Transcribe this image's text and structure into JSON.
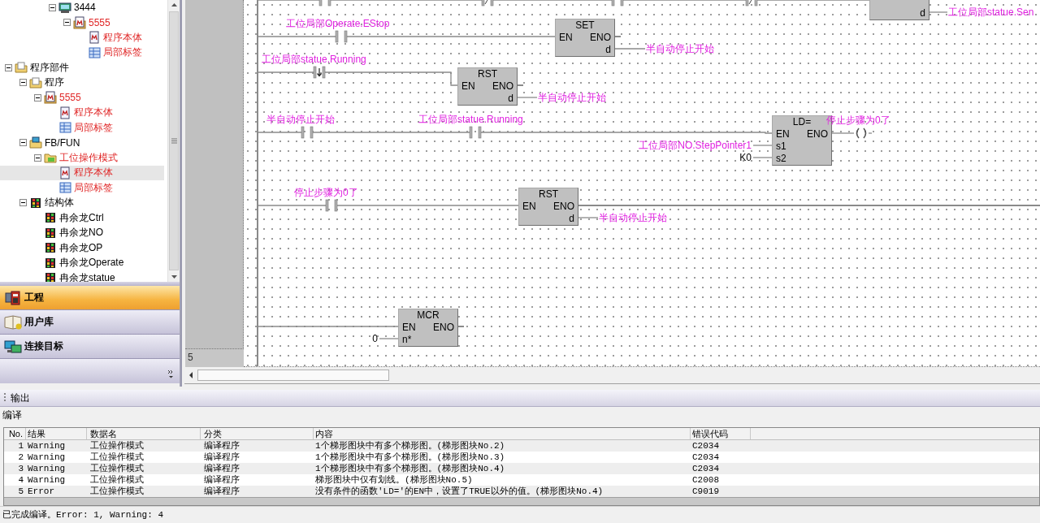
{
  "tree": {
    "scrolled_items": [
      {
        "label": "3444",
        "kind": "module",
        "error": false,
        "selected": false,
        "expanded": true,
        "children": [
          {
            "label": "5555",
            "kind": "pou",
            "error": true,
            "selected": false,
            "expanded": true,
            "children": [
              {
                "label": "程序本体",
                "kind": "body",
                "error": true,
                "selected": false
              },
              {
                "label": "局部标签",
                "kind": "label",
                "error": true,
                "selected": false
              }
            ]
          }
        ]
      }
    ],
    "items": [
      {
        "label": "程序部件",
        "kind": "folder",
        "error": false,
        "selected": false,
        "expanded": true,
        "children": [
          {
            "label": "程序",
            "kind": "folder",
            "error": false,
            "selected": false,
            "expanded": true,
            "children": [
              {
                "label": "5555",
                "kind": "pou",
                "error": true,
                "selected": false,
                "expanded": true,
                "children": [
                  {
                    "label": "程序本体",
                    "kind": "body",
                    "error": true,
                    "selected": false
                  },
                  {
                    "label": "局部标签",
                    "kind": "label",
                    "error": true,
                    "selected": false
                  }
                ]
              }
            ]
          },
          {
            "label": "FB/FUN",
            "kind": "fbfolder",
            "error": false,
            "selected": false,
            "expanded": true,
            "children": [
              {
                "label": "工位操作模式",
                "kind": "fb",
                "error": true,
                "selected": false,
                "expanded": true,
                "children": [
                  {
                    "label": "程序本体",
                    "kind": "body",
                    "error": true,
                    "selected": true
                  },
                  {
                    "label": "局部标签",
                    "kind": "label",
                    "error": true,
                    "selected": false
                  }
                ]
              }
            ]
          },
          {
            "label": "结构体",
            "kind": "struct",
            "error": false,
            "selected": false,
            "expanded": true,
            "children": [
              {
                "label": "冉余龙Ctrl",
                "kind": "struct",
                "error": false,
                "selected": false
              },
              {
                "label": "冉余龙NO",
                "kind": "struct",
                "error": false,
                "selected": false
              },
              {
                "label": "冉余龙OP",
                "kind": "struct",
                "error": false,
                "selected": false
              },
              {
                "label": "冉余龙Operate",
                "kind": "struct",
                "error": false,
                "selected": false
              },
              {
                "label": "冉余龙statue",
                "kind": "struct",
                "error": false,
                "selected": false
              }
            ]
          }
        ]
      }
    ]
  },
  "nav": [
    {
      "label": "工程",
      "kind": "project",
      "selected": true
    },
    {
      "label": "用户库",
      "kind": "library",
      "selected": false
    },
    {
      "label": "连接目标",
      "kind": "connection",
      "selected": false
    }
  ],
  "ladder": {
    "rungs": [
      {
        "contacts": [
          {
            "kind": "no"
          },
          {
            "kind": "nc"
          },
          {
            "kind": "no"
          },
          {
            "kind": "nc"
          }
        ],
        "block": {
          "outputs": [
            {
              "pin": "d",
              "target": "工位局部statue.Sen"
            }
          ]
        }
      },
      {
        "contacts": [
          {
            "label": "工位局部Operate.EStop",
            "kind": "no"
          }
        ],
        "block": {
          "name": "SET",
          "en": "EN",
          "eno": "ENO",
          "eno_continues": false,
          "outputs": [
            {
              "pin": "d",
              "target": "半自动停止开始"
            }
          ]
        }
      },
      {
        "contacts": [
          {
            "label": "工位局部statue.Running",
            "kind": "falling"
          }
        ],
        "block": {
          "name": "RST",
          "en": "EN",
          "eno": "ENO",
          "eno_continues": false,
          "outputs": [
            {
              "pin": "d",
              "target": "半自动停止开始"
            }
          ]
        }
      },
      {
        "contacts": [
          {
            "label": "半自动停止开始",
            "kind": "no"
          },
          {
            "label": "工位局部statue.Running",
            "kind": "no"
          }
        ],
        "block": {
          "name": "LD=",
          "en": "EN",
          "eno": "ENO",
          "inputs": [
            {
              "pin": "s1",
              "source": "工位局部NO.StepPointer1",
              "kind": "variable"
            },
            {
              "pin": "s2",
              "source": "K0",
              "kind": "constant"
            }
          ]
        },
        "coil": {
          "label": "停止步骤为0了"
        }
      },
      {
        "contacts": [
          {
            "label": "停止步骤为0了",
            "kind": "no"
          }
        ],
        "block": {
          "name": "RST",
          "en": "EN",
          "eno": "ENO",
          "eno_continues": true,
          "outputs": [
            {
              "pin": "d",
              "target": "半自动停止开始"
            }
          ]
        }
      },
      {
        "block": {
          "name": "MCR",
          "en": "EN",
          "eno": "ENO",
          "eno_continues": false,
          "inputs": [
            {
              "pin": "n*",
              "source": "0",
              "kind": "constant"
            }
          ]
        }
      }
    ],
    "row_number": "5"
  },
  "output": {
    "title": "输出",
    "section": "编译",
    "columns": [
      "No.",
      "结果",
      "数据名",
      "分类",
      "内容",
      "错误代码"
    ],
    "rows": [
      [
        "1",
        "Warning",
        "工位操作模式",
        "编译程序",
        "1个梯形图块中有多个梯形图。(梯形图块No.2)",
        "C2034"
      ],
      [
        "2",
        "Warning",
        "工位操作模式",
        "编译程序",
        "1个梯形图块中有多个梯形图。(梯形图块No.3)",
        "C2034"
      ],
      [
        "3",
        "Warning",
        "工位操作模式",
        "编译程序",
        "1个梯形图块中有多个梯形图。(梯形图块No.4)",
        "C2034"
      ],
      [
        "4",
        "Warning",
        "工位操作模式",
        "编译程序",
        "梯形图块中仅有划线。(梯形图块No.5)",
        "C2008"
      ],
      [
        "5",
        "Error",
        "工位操作模式",
        "编译程序",
        "没有条件的函数'LD='的EN中，设置了TRUE以外的值。(梯形图块No.4)",
        "C9019"
      ]
    ],
    "status": "已完成编译。Error: 1, Warning: 4"
  }
}
